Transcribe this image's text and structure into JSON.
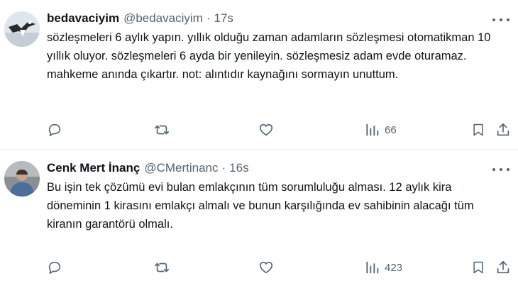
{
  "tweets": [
    {
      "name": "bedavaciyim",
      "handle": "@bedavaciyim",
      "separator": "·",
      "time": "17s",
      "text": "sözleşmeleri 6 aylık yapın. yıllık olduğu zaman adamların sözleşmesi otomatikman 10 yıllık oluyor. sözleşmeleri 6 ayda bir yenileyin. sözleşmesiz adam evde oturamaz. mahkeme anında çıkartır. not: alıntıdır kaynağını sormayın unuttum.",
      "views": "66"
    },
    {
      "name": "Cenk Mert İnanç",
      "handle": "@CMertinanc",
      "separator": "·",
      "time": "16s",
      "text": "Bu işin tek çözümü evi bulan emlakçının tüm sorumluluğu alması. 12 aylık kira döneminin 1 kirasını emlakçı almalı ve bunun karşılığında ev sahibinin alacağı tüm kiranın garantörü olmalı.",
      "views": "423"
    }
  ],
  "colors": {
    "text": "#0f1419",
    "secondary": "#536471",
    "divider": "#eff3f4"
  },
  "icons": [
    "reply-icon",
    "retweet-icon",
    "like-icon",
    "views-icon",
    "bookmark-icon",
    "share-icon",
    "more-icon"
  ]
}
